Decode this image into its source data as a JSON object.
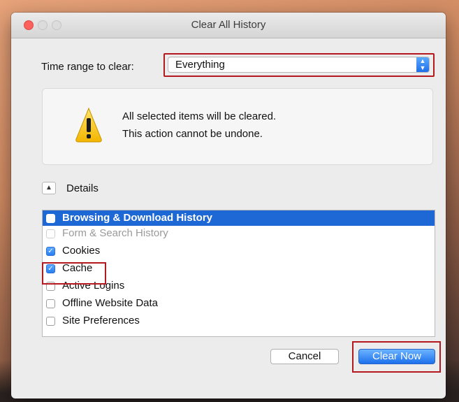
{
  "window": {
    "title": "Clear All History"
  },
  "time_range": {
    "label": "Time range to clear:",
    "selected": "Everything"
  },
  "warning": {
    "line1": "All selected items will be cleared.",
    "line2": "This action cannot be undone.",
    "icon": "warning-icon"
  },
  "details": {
    "label": "Details",
    "expanded": true
  },
  "items": [
    {
      "label": "Browsing & Download History",
      "checked": false,
      "selected": true,
      "disabled": false
    },
    {
      "label": "Form & Search History",
      "checked": false,
      "selected": false,
      "disabled": true
    },
    {
      "label": "Cookies",
      "checked": true,
      "selected": false,
      "disabled": false
    },
    {
      "label": "Cache",
      "checked": true,
      "selected": false,
      "disabled": false
    },
    {
      "label": "Active Logins",
      "checked": false,
      "selected": false,
      "disabled": false
    },
    {
      "label": "Offline Website Data",
      "checked": false,
      "selected": false,
      "disabled": false
    },
    {
      "label": "Site Preferences",
      "checked": false,
      "selected": false,
      "disabled": false
    }
  ],
  "buttons": {
    "cancel": "Cancel",
    "clear_now": "Clear Now"
  },
  "colors": {
    "highlight_border": "#b3191f",
    "selection_blue": "#1e68d6",
    "accent_blue": "#2a7ef2"
  }
}
